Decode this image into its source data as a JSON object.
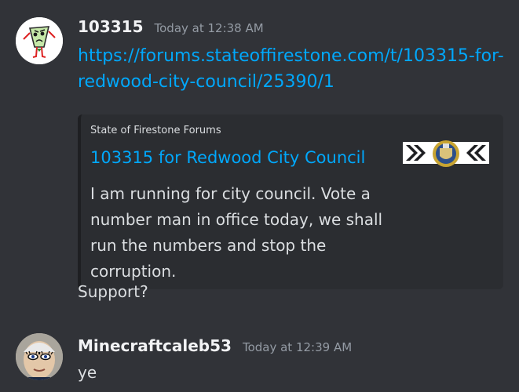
{
  "messages": [
    {
      "username": "103315",
      "timestamp": "Today at 12:38 AM",
      "link_text": "https://forums.stateoffirestone.com/t/103315-for-redwood-city-council/25390/1",
      "embed": {
        "provider": "State of Firestone Forums",
        "title": "103315 for Redwood City Council",
        "description": "I am running for city council. Vote a number man in office today, we shall run the numbers and stop the corruption.",
        "thumbnail_icon": "forum-crest-icon"
      },
      "text": "Support?"
    },
    {
      "username": "Minecraftcaleb53",
      "timestamp": "Today at 12:39 AM",
      "text": "ye"
    }
  ],
  "colors": {
    "background": "#313338",
    "link": "#00a8fc",
    "embed_background": "#2b2d31"
  }
}
